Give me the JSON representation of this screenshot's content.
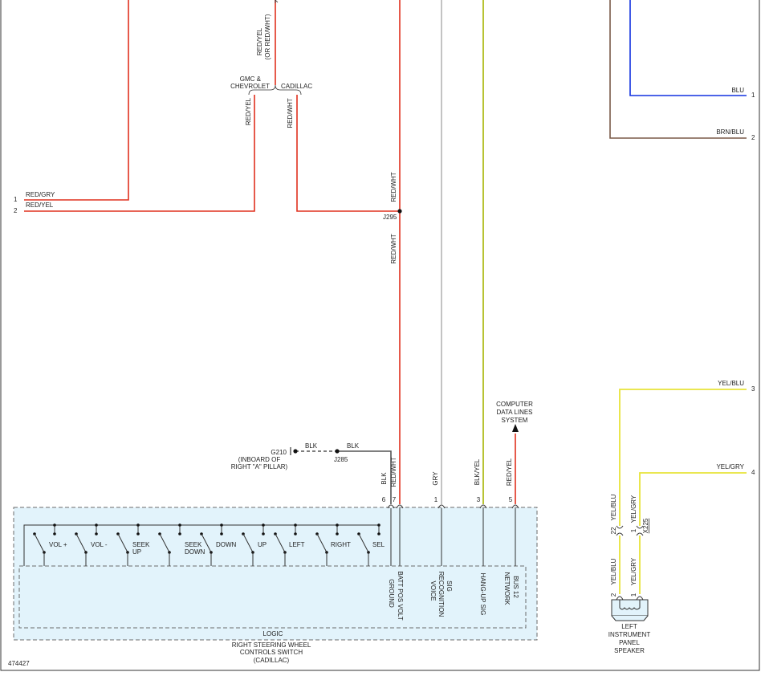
{
  "diagram_id": "474427",
  "colors": {
    "red": "#e0301e",
    "gray": "#b4b4b4",
    "yellow_green": "#a6b400",
    "yellow": "#e8e43a",
    "blue": "#1030e0",
    "brown": "#7a5a48",
    "black": "#333333",
    "box_fill": "#e2f3fb",
    "box_border": "#6b6b6b"
  },
  "top_splice": {
    "wire_label_line1": "RED/YEL",
    "wire_label_line2": "(OR RED/WHT)",
    "left_option_line1": "GMC &",
    "left_option_line2": "CHEVROLET",
    "right_option": "CADILLAC",
    "left_branch_wire": "RED/YEL",
    "right_branch_wire": "RED/WHT"
  },
  "left_pins": [
    {
      "number": "1",
      "wire": "RED/GRY"
    },
    {
      "number": "2",
      "wire": "RED/YEL"
    }
  ],
  "junction_j295": {
    "name": "J295",
    "wire_above": "RED/WHT",
    "wire_below": "RED/WHT"
  },
  "right_pins": [
    {
      "number": "1",
      "wire": "BLU"
    },
    {
      "number": "2",
      "wire": "BRN/BLU"
    },
    {
      "number": "3",
      "wire": "YEL/BLU"
    },
    {
      "number": "4",
      "wire": "YEL/GRY"
    }
  ],
  "ground": {
    "name": "G210",
    "location_line1": "(INBOARD OF",
    "location_line2": "RIGHT \"A\" PILLAR)",
    "wire_left": "BLK",
    "wire_right": "BLK",
    "junction": "J285"
  },
  "computer_data_lines": {
    "line1": "COMPUTER",
    "line2": "DATA LINES",
    "line3": "SYSTEM"
  },
  "switch_module": {
    "name_line1": "RIGHT STEERING WHEEL",
    "name_line2": "CONTROLS SWITCH",
    "name_line3": "(CADILLAC)",
    "logic_label": "LOGIC",
    "switches": [
      {
        "label": "VOL +"
      },
      {
        "label": "VOL -"
      },
      {
        "label_line1": "SEEK",
        "label_line2": "UP"
      },
      {
        "label_line1": "SEEK",
        "label_line2": "DOWN"
      },
      {
        "label": "DOWN"
      },
      {
        "label": "UP"
      },
      {
        "label": "LEFT"
      },
      {
        "label": "RIGHT"
      },
      {
        "label": "SEL"
      }
    ],
    "pins": [
      {
        "number": "6",
        "wire": "BLK",
        "function": "GROUND"
      },
      {
        "number": "7",
        "wire": "RED/WHT",
        "function": "BATT POS VOLT"
      },
      {
        "number": "1",
        "wire": "GRY",
        "function_line1": "VOICE",
        "function_line2": "RECOGNITION",
        "function_line3": "SIG"
      },
      {
        "number": "3",
        "wire": "BLK/YEL",
        "function": "HANG-UP SIG"
      },
      {
        "number": "5",
        "wire": "RED/YEL",
        "function_line1": "NETWORK",
        "function_line2": "BUS 12"
      }
    ]
  },
  "connector_x225": {
    "name": "X225",
    "pins": [
      {
        "number": "22",
        "wire": "YEL/BLU"
      },
      {
        "number": "1",
        "wire": "YEL/GRY"
      }
    ]
  },
  "speaker": {
    "name_line1": "LEFT",
    "name_line2": "INSTRUMENT",
    "name_line3": "PANEL",
    "name_line4": "SPEAKER",
    "pins": [
      {
        "number": "2",
        "wire": "YEL/BLU"
      },
      {
        "number": "1",
        "wire": "YEL/GRY"
      }
    ]
  }
}
